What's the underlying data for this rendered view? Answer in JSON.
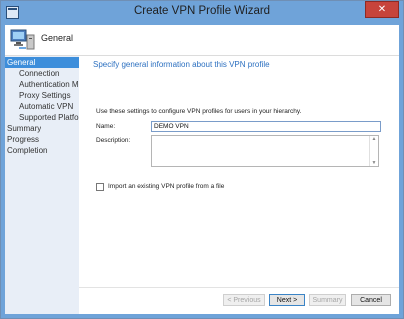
{
  "window": {
    "title": "Create VPN Profile Wizard",
    "close_symbol": "✕"
  },
  "header": {
    "label": "General",
    "icon": "computer-icon"
  },
  "sidebar": {
    "items": [
      {
        "label": "General",
        "level": "top",
        "active": true
      },
      {
        "label": "Connection",
        "level": "sub",
        "active": false
      },
      {
        "label": "Authentication Meth",
        "level": "sub",
        "active": false
      },
      {
        "label": "Proxy Settings",
        "level": "sub",
        "active": false
      },
      {
        "label": "Automatic VPN",
        "level": "sub",
        "active": false
      },
      {
        "label": "Supported Platform",
        "level": "sub",
        "active": false
      },
      {
        "label": "Summary",
        "level": "top",
        "active": false
      },
      {
        "label": "Progress",
        "level": "top",
        "active": false
      },
      {
        "label": "Completion",
        "level": "top",
        "active": false
      }
    ]
  },
  "main": {
    "heading": "Specify general information about this VPN profile",
    "intro": "Use these settings to configure VPN profiles for users in your hierarchy.",
    "name_label": "Name:",
    "name_value": "DEMO VPN",
    "description_label": "Description:",
    "description_value": "",
    "import_label": "Import an existing VPN profile from a file",
    "import_checked": false
  },
  "buttons": {
    "previous": "< Previous",
    "next": "Next >",
    "summary": "Summary",
    "cancel": "Cancel"
  },
  "colors": {
    "accent": "#3d8edb",
    "heading": "#2c70c0",
    "titlebar": "#6fa3d9",
    "close": "#c7443b"
  }
}
